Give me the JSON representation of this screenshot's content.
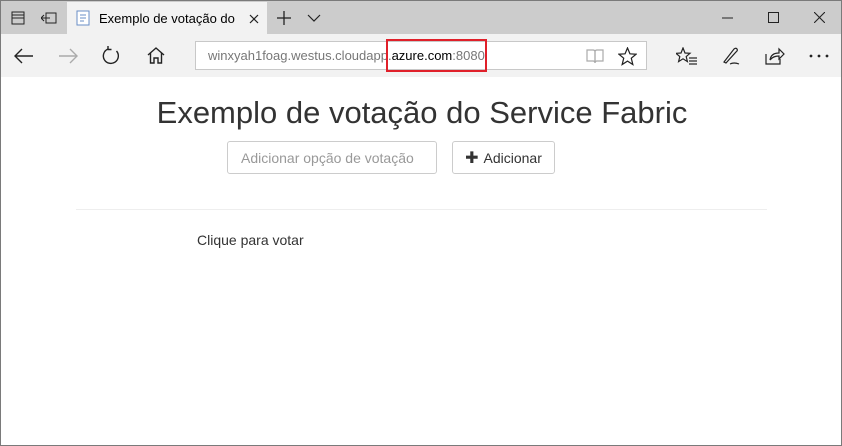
{
  "browser": {
    "tab_title": "Exemplo de votação do",
    "url_prefix": "winxyah1foag.westus.cloudapp.",
    "url_domain": "azure.com",
    "url_port": ":8080",
    "highlight_color": "#e0202a",
    "icons": {
      "tab_set_aside": "tabs-icon",
      "tab_preview": "tab-preview-icon",
      "new_tab": "plus-icon",
      "tab_list": "chevron-down-icon",
      "minimize": "minimize-icon",
      "maximize": "maximize-icon",
      "close": "close-icon",
      "back": "back-arrow-icon",
      "forward": "forward-arrow-icon",
      "refresh": "refresh-icon",
      "home": "home-icon",
      "reading_view": "reading-view-icon",
      "favorite": "star-icon",
      "favorites_hub": "hub-icon",
      "web_note": "pen-icon",
      "share": "share-icon",
      "more": "more-icon"
    }
  },
  "page": {
    "title": "Exemplo de votação do Service Fabric",
    "input_placeholder": "Adicionar opção de votação",
    "add_button_label": "Adicionar",
    "click_to_vote": "Clique para votar"
  }
}
